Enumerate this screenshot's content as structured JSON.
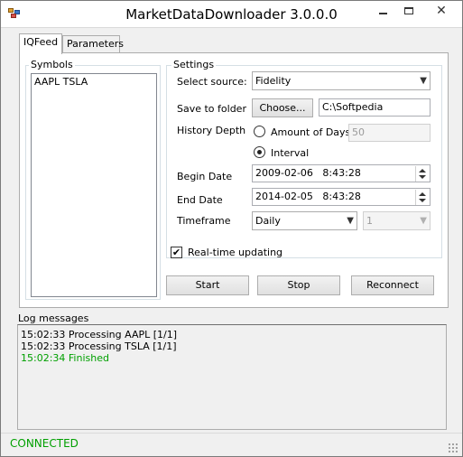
{
  "window": {
    "title": "MarketDataDownloader 3.0.0.0"
  },
  "tabs": [
    {
      "label": "IQFeed",
      "active": true
    },
    {
      "label": "Parameters",
      "active": false
    }
  ],
  "symbols": {
    "label": "Symbols",
    "text": "AAPL TSLA"
  },
  "settings": {
    "label": "Settings",
    "source_label": "Select source:",
    "source_value": "Fidelity",
    "folder_label": "Save to folder",
    "choose_label": "Choose...",
    "folder_value": "C:\\Softpedia",
    "history_label": "History Depth",
    "amount_label": "Amount of Days",
    "amount_value": "50",
    "interval_label": "Interval",
    "history_mode": "Interval",
    "begin_label": "Begin Date",
    "begin_value": "2009-02-06   8:43:28",
    "end_label": "End Date",
    "end_value": "2014-02-05   8:43:28",
    "timeframe_label": "Timeframe",
    "timeframe_value": "Daily",
    "timeframe_count": "1",
    "realtime_label": "Real-time updating",
    "realtime_checked": true
  },
  "buttons": {
    "start": "Start",
    "stop": "Stop",
    "reconnect": "Reconnect"
  },
  "log": {
    "label": "Log messages",
    "lines": [
      {
        "text": "15:02:33 Processing AAPL [1/1]",
        "type": "info"
      },
      {
        "text": "15:02:33 Processing TSLA [1/1]",
        "type": "info"
      },
      {
        "text": "15:02:34 Finished",
        "type": "success"
      }
    ]
  },
  "status": {
    "text": "CONNECTED",
    "color": "#00a000"
  }
}
